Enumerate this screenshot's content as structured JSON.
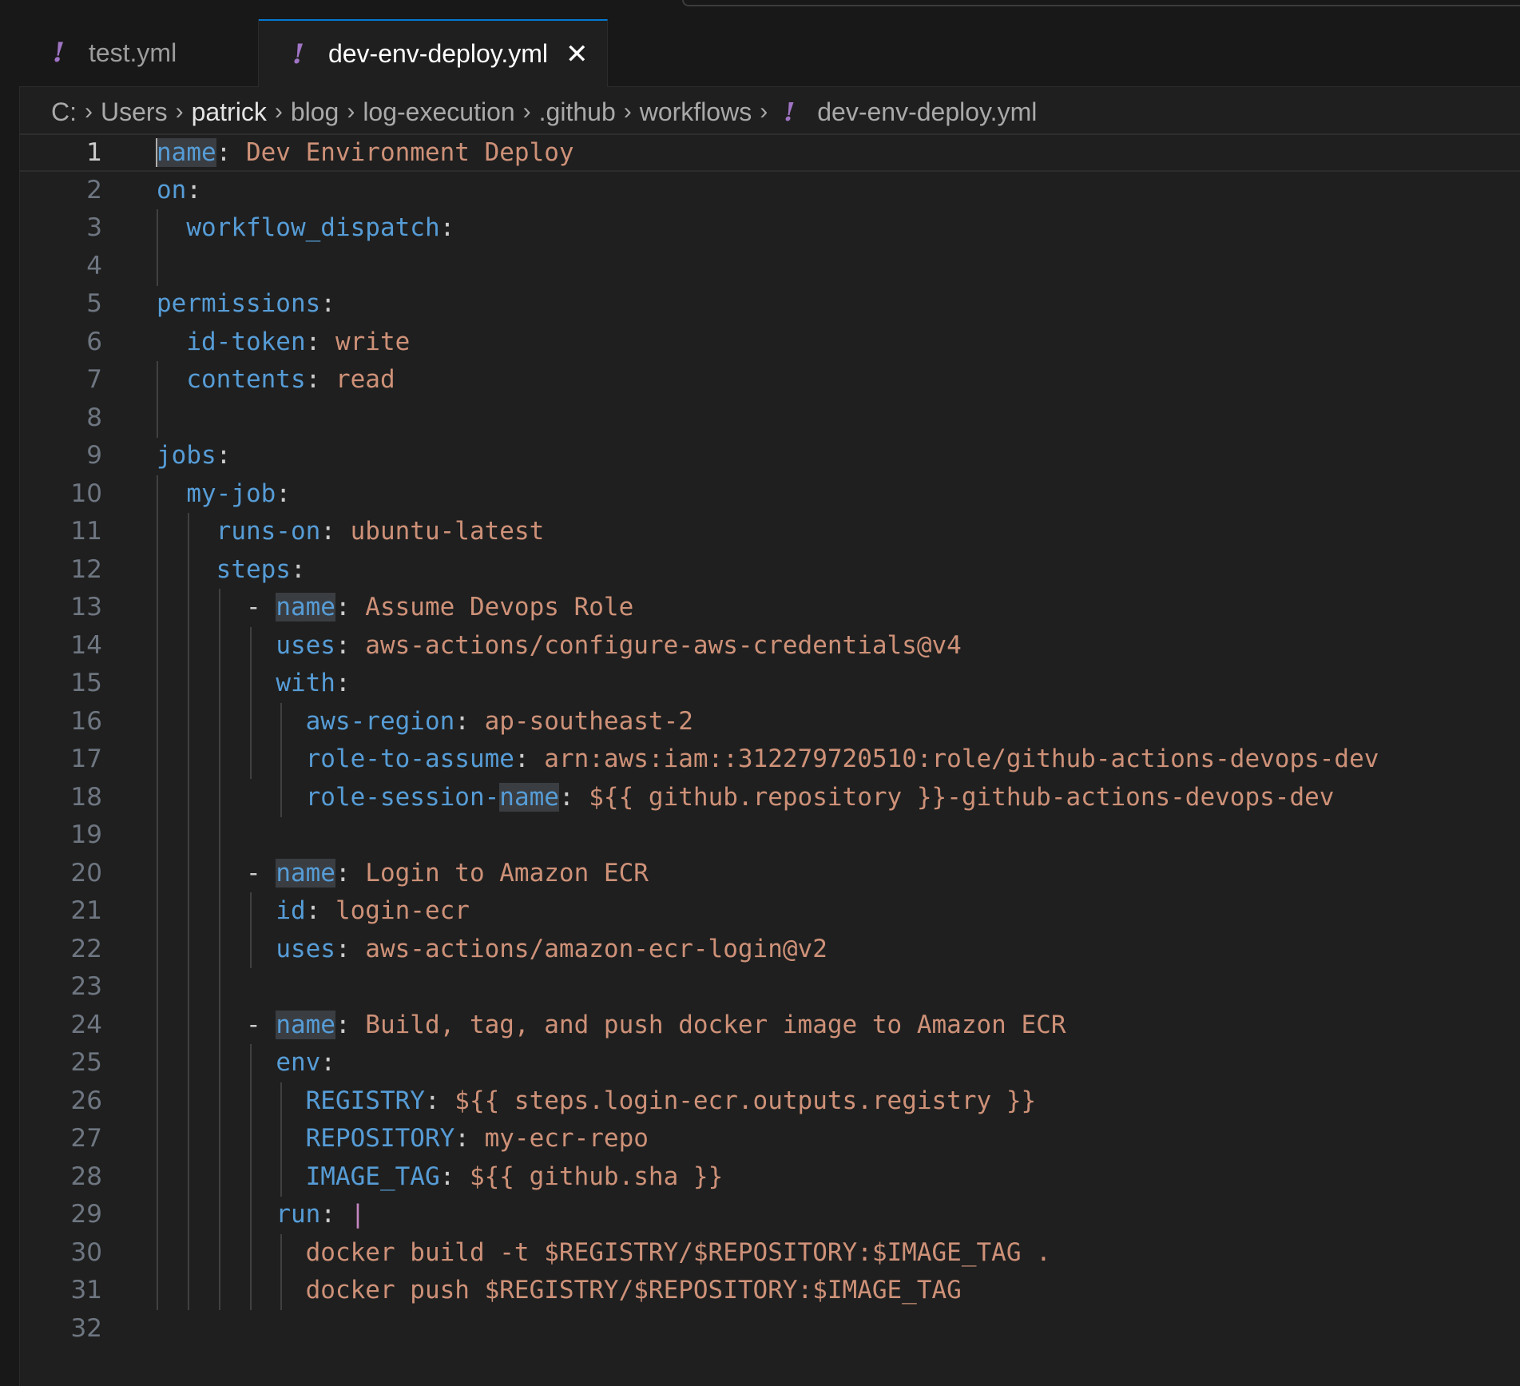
{
  "tabs": [
    {
      "label": "test.yml",
      "icon": "yaml-exclamation-icon",
      "active": false
    },
    {
      "label": "dev-env-deploy.yml",
      "icon": "yaml-exclamation-icon",
      "active": true
    }
  ],
  "breadcrumb": [
    "C:",
    "Users",
    "patrick",
    "blog",
    "log-execution",
    ".github",
    "workflows",
    "dev-env-deploy.yml"
  ],
  "colors": {
    "key": "#569cd6",
    "value": "#ce9178",
    "punct": "#cccccc",
    "background": "#1f1f1f",
    "line_number": "#6e7681"
  },
  "lines": [
    {
      "n": "1",
      "tokens": [
        {
          "t": "name",
          "c": "k",
          "hl": true
        },
        {
          "t": ": ",
          "c": "p"
        },
        {
          "t": "Dev Environment Deploy",
          "c": "v"
        }
      ]
    },
    {
      "n": "2",
      "tokens": [
        {
          "t": "on",
          "c": "k"
        },
        {
          "t": ":",
          "c": "p"
        }
      ]
    },
    {
      "n": "3",
      "tokens": [
        {
          "t": "  "
        },
        {
          "t": "workflow_dispatch",
          "c": "k"
        },
        {
          "t": ":",
          "c": "p"
        }
      ]
    },
    {
      "n": "4",
      "tokens": []
    },
    {
      "n": "5",
      "tokens": [
        {
          "t": "permissions",
          "c": "k"
        },
        {
          "t": ":",
          "c": "p"
        }
      ]
    },
    {
      "n": "6",
      "tokens": [
        {
          "t": "  "
        },
        {
          "t": "id-token",
          "c": "k"
        },
        {
          "t": ": ",
          "c": "p"
        },
        {
          "t": "write",
          "c": "v"
        }
      ]
    },
    {
      "n": "7",
      "tokens": [
        {
          "t": "  "
        },
        {
          "t": "contents",
          "c": "k"
        },
        {
          "t": ": ",
          "c": "p"
        },
        {
          "t": "read",
          "c": "v"
        }
      ]
    },
    {
      "n": "8",
      "tokens": []
    },
    {
      "n": "9",
      "tokens": [
        {
          "t": "jobs",
          "c": "k"
        },
        {
          "t": ":",
          "c": "p"
        }
      ]
    },
    {
      "n": "10",
      "tokens": [
        {
          "t": "  "
        },
        {
          "t": "my-job",
          "c": "k"
        },
        {
          "t": ":",
          "c": "p"
        }
      ]
    },
    {
      "n": "11",
      "tokens": [
        {
          "t": "    "
        },
        {
          "t": "runs-on",
          "c": "k"
        },
        {
          "t": ": ",
          "c": "p"
        },
        {
          "t": "ubuntu-latest",
          "c": "v"
        }
      ]
    },
    {
      "n": "12",
      "tokens": [
        {
          "t": "    "
        },
        {
          "t": "steps",
          "c": "k"
        },
        {
          "t": ":",
          "c": "p"
        }
      ]
    },
    {
      "n": "13",
      "tokens": [
        {
          "t": "      "
        },
        {
          "t": "- ",
          "c": "p"
        },
        {
          "t": "name",
          "c": "k",
          "hl": true
        },
        {
          "t": ": ",
          "c": "p"
        },
        {
          "t": "Assume Devops Role",
          "c": "v"
        }
      ]
    },
    {
      "n": "14",
      "tokens": [
        {
          "t": "        "
        },
        {
          "t": "uses",
          "c": "k"
        },
        {
          "t": ": ",
          "c": "p"
        },
        {
          "t": "aws-actions/configure-aws-credentials@v4",
          "c": "v"
        }
      ]
    },
    {
      "n": "15",
      "tokens": [
        {
          "t": "        "
        },
        {
          "t": "with",
          "c": "k"
        },
        {
          "t": ":",
          "c": "p"
        }
      ]
    },
    {
      "n": "16",
      "tokens": [
        {
          "t": "          "
        },
        {
          "t": "aws-region",
          "c": "k"
        },
        {
          "t": ": ",
          "c": "p"
        },
        {
          "t": "ap-southeast-2",
          "c": "v"
        }
      ]
    },
    {
      "n": "17",
      "tokens": [
        {
          "t": "          "
        },
        {
          "t": "role-to-assume",
          "c": "k"
        },
        {
          "t": ": ",
          "c": "p"
        },
        {
          "t": "arn:aws:iam::312279720510:role/github-actions-devops-dev",
          "c": "v"
        }
      ]
    },
    {
      "n": "18",
      "tokens": [
        {
          "t": "          "
        },
        {
          "t": "role-session-",
          "c": "k"
        },
        {
          "t": "name",
          "c": "k",
          "hl": true
        },
        {
          "t": ": ",
          "c": "p"
        },
        {
          "t": "${{ github.repository }}-github-actions-devops-dev",
          "c": "v"
        }
      ]
    },
    {
      "n": "19",
      "tokens": []
    },
    {
      "n": "20",
      "tokens": [
        {
          "t": "      "
        },
        {
          "t": "- ",
          "c": "p"
        },
        {
          "t": "name",
          "c": "k",
          "hl": true
        },
        {
          "t": ": ",
          "c": "p"
        },
        {
          "t": "Login to Amazon ECR",
          "c": "v"
        }
      ]
    },
    {
      "n": "21",
      "tokens": [
        {
          "t": "        "
        },
        {
          "t": "id",
          "c": "k"
        },
        {
          "t": ": ",
          "c": "p"
        },
        {
          "t": "login-ecr",
          "c": "v"
        }
      ]
    },
    {
      "n": "22",
      "tokens": [
        {
          "t": "        "
        },
        {
          "t": "uses",
          "c": "k"
        },
        {
          "t": ": ",
          "c": "p"
        },
        {
          "t": "aws-actions/amazon-ecr-login@v2",
          "c": "v"
        }
      ]
    },
    {
      "n": "23",
      "tokens": []
    },
    {
      "n": "24",
      "tokens": [
        {
          "t": "      "
        },
        {
          "t": "- ",
          "c": "p"
        },
        {
          "t": "name",
          "c": "k",
          "hl": true
        },
        {
          "t": ": ",
          "c": "p"
        },
        {
          "t": "Build, tag, and push docker image to Amazon ECR",
          "c": "v"
        }
      ]
    },
    {
      "n": "25",
      "tokens": [
        {
          "t": "        "
        },
        {
          "t": "env",
          "c": "k"
        },
        {
          "t": ":",
          "c": "p"
        }
      ]
    },
    {
      "n": "26",
      "tokens": [
        {
          "t": "          "
        },
        {
          "t": "REGISTRY",
          "c": "k"
        },
        {
          "t": ": ",
          "c": "p"
        },
        {
          "t": "${{ steps.login-ecr.outputs.registry }}",
          "c": "v"
        }
      ]
    },
    {
      "n": "27",
      "tokens": [
        {
          "t": "          "
        },
        {
          "t": "REPOSITORY",
          "c": "k"
        },
        {
          "t": ": ",
          "c": "p"
        },
        {
          "t": "my-ecr-repo",
          "c": "v"
        }
      ]
    },
    {
      "n": "28",
      "tokens": [
        {
          "t": "          "
        },
        {
          "t": "IMAGE_TAG",
          "c": "k"
        },
        {
          "t": ": ",
          "c": "p"
        },
        {
          "t": "${{ github.sha }}",
          "c": "v"
        }
      ]
    },
    {
      "n": "29",
      "tokens": [
        {
          "t": "        "
        },
        {
          "t": "run",
          "c": "k"
        },
        {
          "t": ": ",
          "c": "p"
        },
        {
          "t": "|",
          "c": "pipe"
        }
      ]
    },
    {
      "n": "30",
      "tokens": [
        {
          "t": "          "
        },
        {
          "t": "docker build -t $REGISTRY/$REPOSITORY:$IMAGE_TAG .",
          "c": "v"
        }
      ]
    },
    {
      "n": "31",
      "tokens": [
        {
          "t": "          "
        },
        {
          "t": "docker push $REGISTRY/$REPOSITORY:$IMAGE_TAG",
          "c": "v"
        }
      ]
    },
    {
      "n": "32",
      "tokens": []
    }
  ]
}
